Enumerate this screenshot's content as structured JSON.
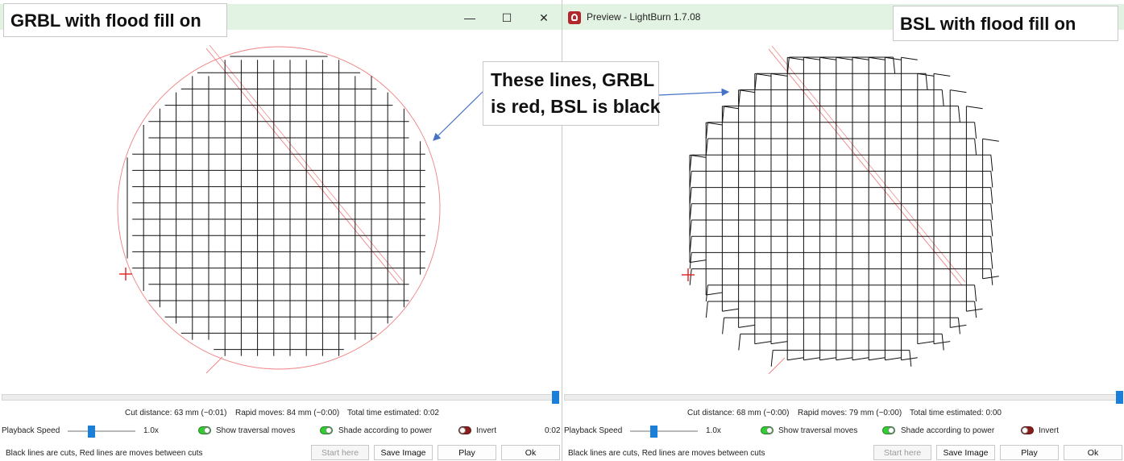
{
  "left_window": {
    "controls": {
      "minimize": "—",
      "maximize": "☐",
      "close": "✕"
    },
    "stats": {
      "cut_distance": "Cut distance: 63 mm (~0:01)",
      "rapid_moves": "Rapid moves: 84 mm (~0:00)",
      "total_time": "Total time estimated: 0:02"
    },
    "playback_label": "Playback Speed",
    "speed_value": "1.0x",
    "speed_level": 0.35,
    "show_traversal": "Show traversal moves",
    "shade_power": "Shade according to power",
    "invert": "Invert",
    "time_readout": "0:02",
    "legend_text": "Black lines are cuts, Red lines are moves between cuts",
    "buttons": {
      "start_here": "Start here",
      "save_image": "Save Image",
      "play": "Play",
      "ok": "Ok"
    }
  },
  "right_window": {
    "title": "Preview - LightBurn 1.7.08",
    "stats": {
      "cut_distance": "Cut distance: 68 mm (~0:00)",
      "rapid_moves": "Rapid moves: 79 mm (~0:00)",
      "total_time": "Total time estimated: 0:00"
    },
    "playback_label": "Playback Speed",
    "speed_value": "1.0x",
    "speed_level": 0.35,
    "show_traversal": "Show traversal moves",
    "shade_power": "Shade according to power",
    "invert": "Invert",
    "legend_text": "Black lines are cuts, Red lines are moves between cuts",
    "buttons": {
      "start_here": "Start here",
      "save_image": "Save Image",
      "play": "Play",
      "ok": "Ok"
    }
  },
  "annotations": {
    "grbl_label": "GRBL with flood fill on",
    "bsl_label": "BSL with flood fill on",
    "callout_line1": "These lines, GRBL",
    "callout_line2": "is red, BSL is black"
  },
  "colors": {
    "cut": "#111111",
    "move": "#f08080",
    "accent": "#1a7fd8",
    "toggle_on": "#2fcf2f",
    "toggle_off": "#8b1d1d",
    "callout_arrow": "#4472c4",
    "titlebar": "#e3f3e3"
  },
  "icons": {
    "app": "lightburn-icon",
    "origin": "crosshair-icon"
  }
}
